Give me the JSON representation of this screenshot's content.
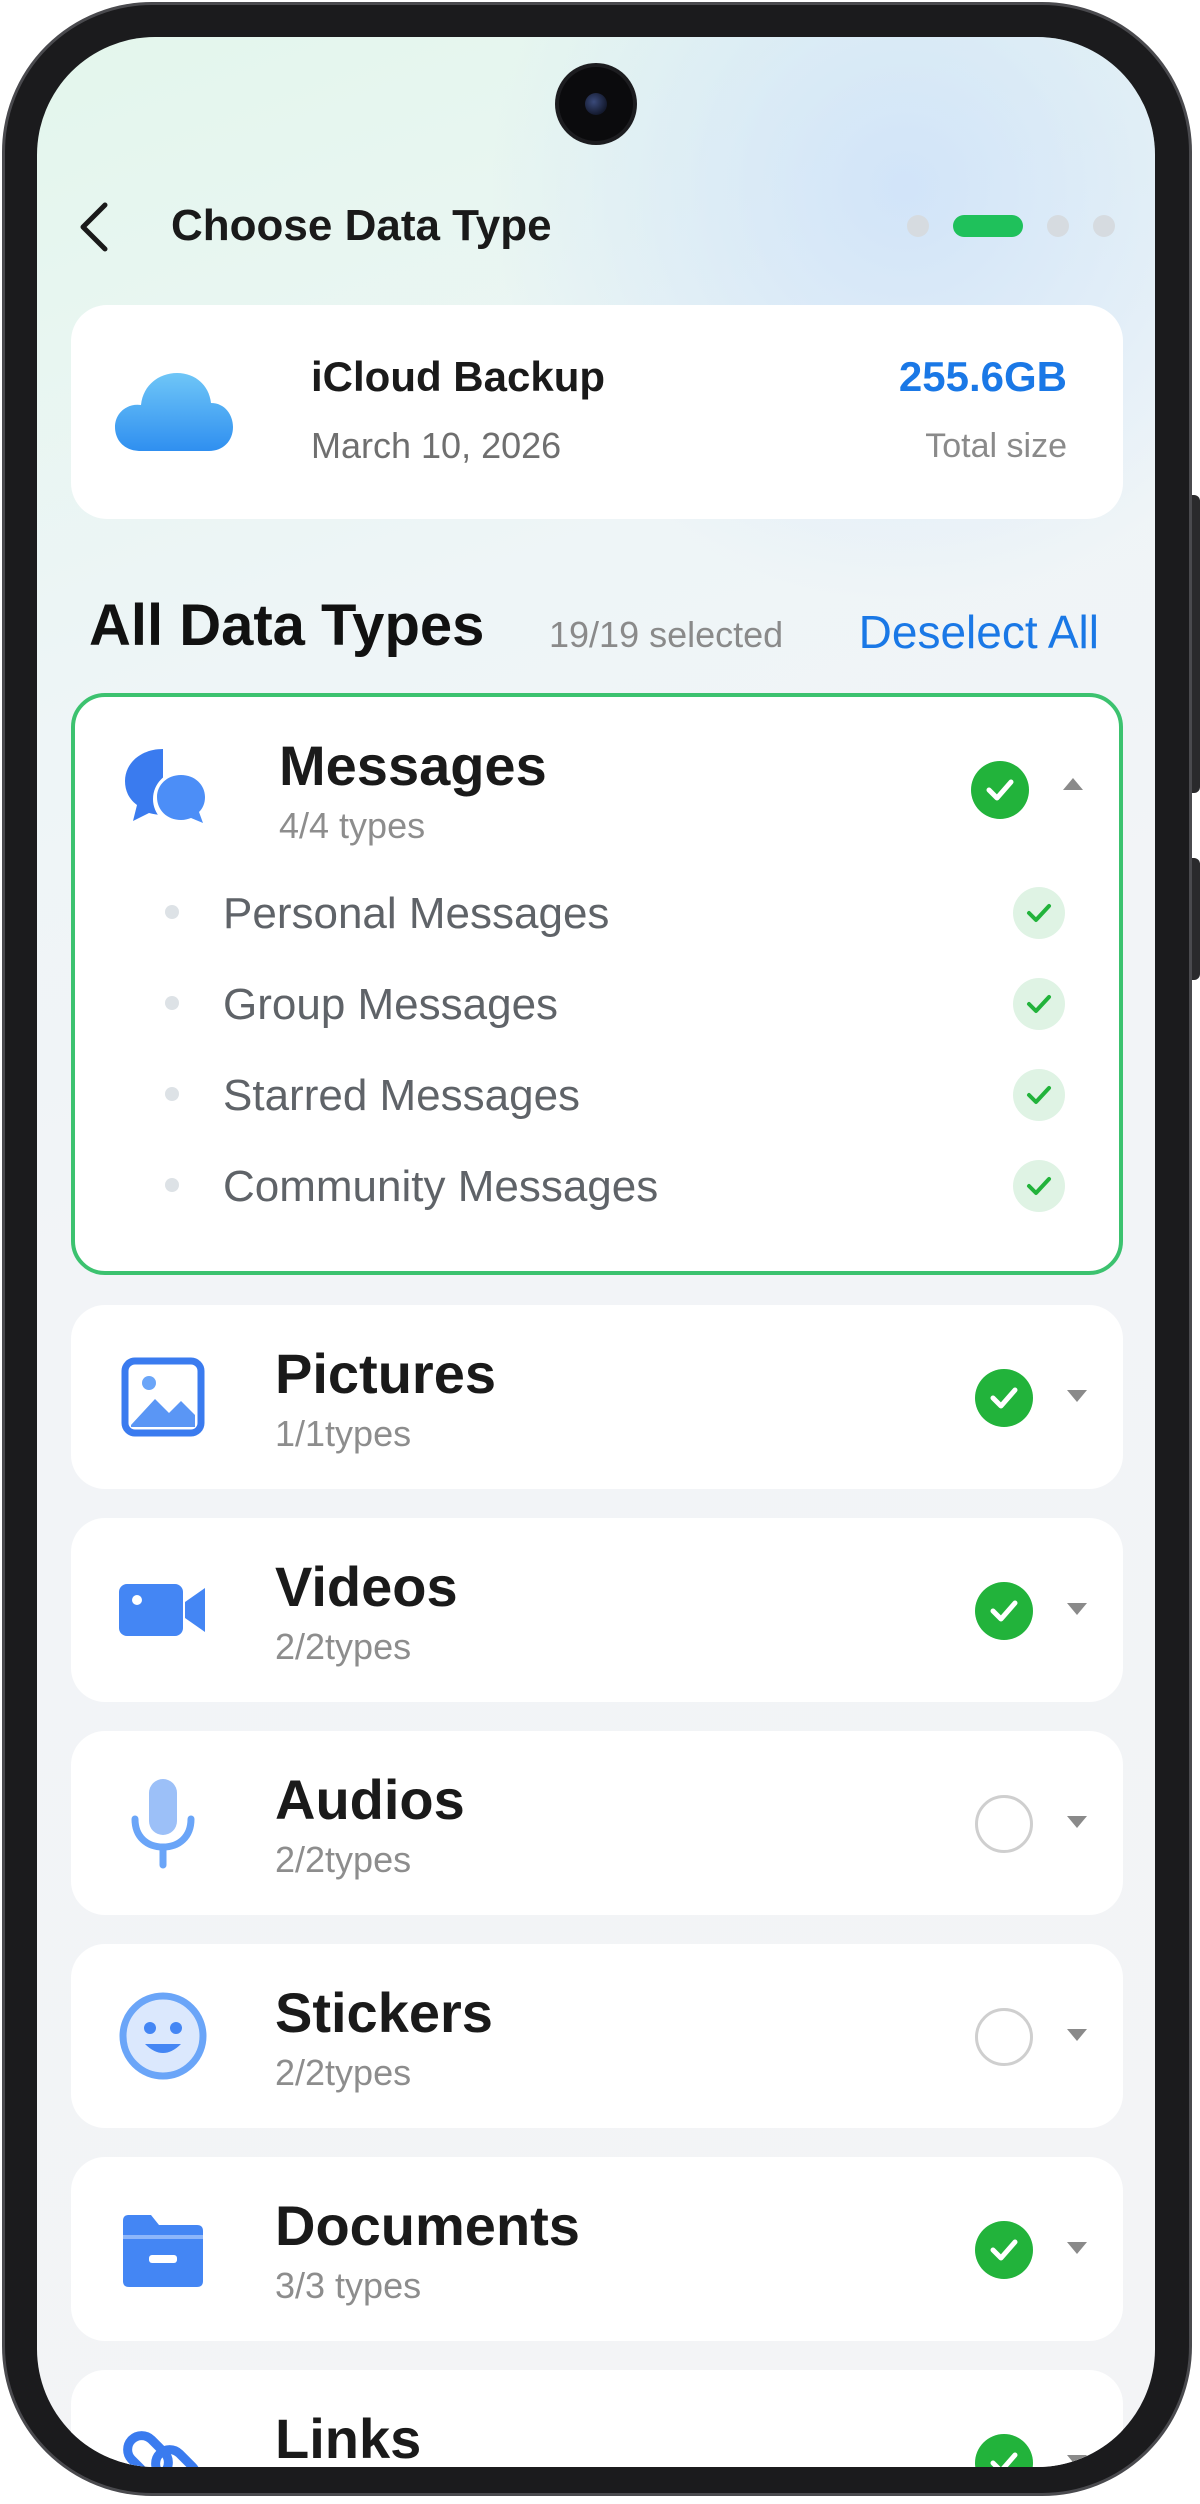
{
  "header": {
    "title": "Choose Data Type"
  },
  "backup": {
    "name": "iCloud Backup",
    "date": "March 10, 2026",
    "size": "255.6GB",
    "size_label": "Total size"
  },
  "section": {
    "title": "All Data Types",
    "selected": "19/19 selected",
    "deselect_label": "Deselect All"
  },
  "colors": {
    "accent_green": "#22b33b",
    "link_blue": "#1a78e6",
    "icon_blue": "#4486f4"
  },
  "categories": [
    {
      "name": "Messages",
      "sub": "4/4 types",
      "icon": "chat-bubbles-icon",
      "selected": true,
      "expanded": true,
      "items": [
        "Personal Messages",
        "Group Messages",
        "Starred Messages",
        "Community Messages"
      ]
    },
    {
      "name": "Pictures",
      "sub": "1/1types",
      "icon": "image-icon",
      "selected": true
    },
    {
      "name": "Videos",
      "sub": "2/2types",
      "icon": "video-camera-icon",
      "selected": true
    },
    {
      "name": "Audios",
      "sub": "2/2types",
      "icon": "microphone-icon",
      "selected": false
    },
    {
      "name": "Stickers",
      "sub": "2/2types",
      "icon": "smiley-icon",
      "selected": false
    },
    {
      "name": "Documents",
      "sub": "3/3 types",
      "icon": "folder-icon",
      "selected": true
    },
    {
      "name": "Links",
      "sub": "",
      "icon": "link-icon",
      "selected": true
    }
  ]
}
